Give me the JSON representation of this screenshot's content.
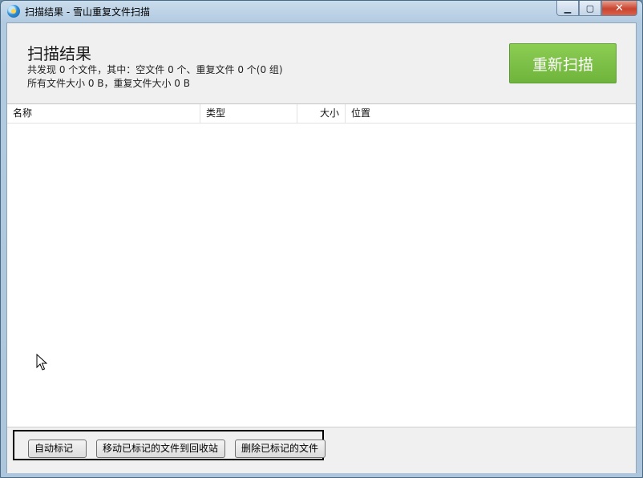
{
  "window": {
    "title": "扫描结果 - 雪山重复文件扫描",
    "controls": {
      "minimize": "▁",
      "maximize": "▢",
      "close": "✕"
    }
  },
  "header": {
    "title": "扫描结果",
    "summary_line1": "共发现 0 个文件，其中：空文件 0 个、重复文件 0 个(0 组)",
    "summary_line2": "所有文件大小 0 B，重复文件大小 0 B",
    "rescan_label": "重新扫描"
  },
  "table": {
    "columns": [
      "名称",
      "类型",
      "大小",
      "位置"
    ],
    "rows": []
  },
  "footer": {
    "auto_mark_label": "自动标记",
    "move_to_recycle_label": "移动已标记的文件到回收站",
    "delete_marked_label": "删除已标记的文件"
  },
  "colors": {
    "accent_green": "#78bb45",
    "close_red": "#c94530"
  }
}
